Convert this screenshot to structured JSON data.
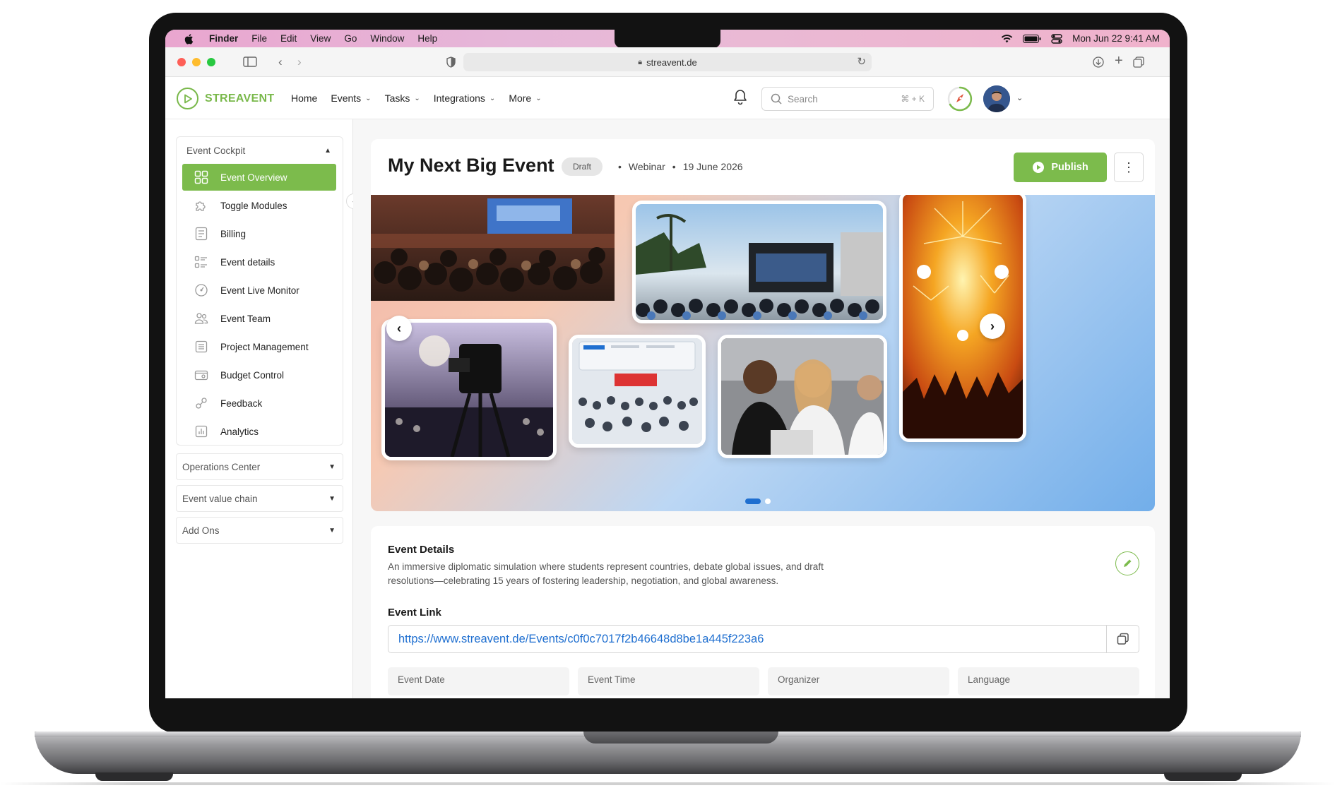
{
  "menubar": {
    "app": "Finder",
    "items": [
      "File",
      "Edit",
      "View",
      "Go",
      "Window",
      "Help"
    ],
    "datetime": "Mon Jun 22  9:41 AM"
  },
  "browser": {
    "url": "streavent.de"
  },
  "header": {
    "brand": "STREAVENT",
    "nav": [
      {
        "label": "Home",
        "has_menu": false
      },
      {
        "label": "Events",
        "has_menu": true
      },
      {
        "label": "Tasks",
        "has_menu": true
      },
      {
        "label": "Integrations",
        "has_menu": true
      },
      {
        "label": "More",
        "has_menu": true
      }
    ],
    "search_placeholder": "Search",
    "search_shortcut": "⌘ + K"
  },
  "sidebar": {
    "cockpit_title": "Event Cockpit",
    "items": [
      {
        "label": "Event Overview",
        "icon": "grid-icon",
        "active": true
      },
      {
        "label": "Toggle Modules",
        "icon": "puzzle-icon",
        "active": false
      },
      {
        "label": "Billing",
        "icon": "receipt-icon",
        "active": false
      },
      {
        "label": "Event details",
        "icon": "list-details-icon",
        "active": false
      },
      {
        "label": "Event Live Monitor",
        "icon": "gauge-icon",
        "active": false
      },
      {
        "label": "Event Team",
        "icon": "team-icon",
        "active": false
      },
      {
        "label": "Project Management",
        "icon": "document-icon",
        "active": false
      },
      {
        "label": "Budget Control",
        "icon": "wallet-icon",
        "active": false
      },
      {
        "label": "Feedback",
        "icon": "feedback-icon",
        "active": false
      },
      {
        "label": "Analytics",
        "icon": "bar-chart-icon",
        "active": false
      }
    ],
    "sections": [
      "Operations Center",
      "Event value chain",
      "Add Ons"
    ]
  },
  "event": {
    "title": "My Next Big Event",
    "status": "Draft",
    "type": "Webinar",
    "date": "19 June 2026",
    "publish_label": "Publish"
  },
  "details": {
    "title": "Event Details",
    "description": "An immersive diplomatic simulation where students represent countries, debate global issues, and draft resolutions—celebrating 15 years of fostering leadership, negotiation, and global awareness.",
    "link_label": "Event Link",
    "link": "https://www.streavent.de/Events/c0f0c7017f2b46648d8be1a445f223a6",
    "fields": [
      "Event Date",
      "Event Time",
      "Organizer",
      "Language"
    ]
  },
  "colors": {
    "brand_green": "#7cbb4c",
    "link_blue": "#1f6fd0"
  }
}
